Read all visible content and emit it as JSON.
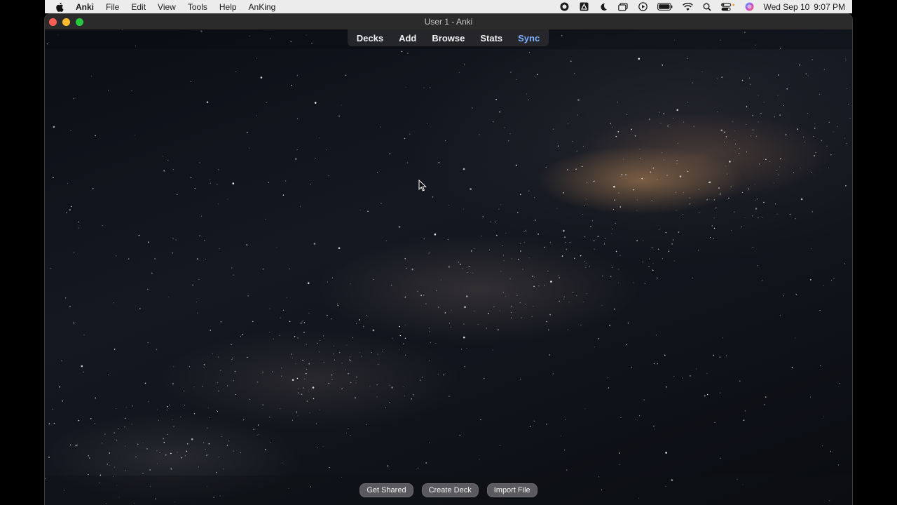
{
  "menubar": {
    "apple_icon": "apple-icon",
    "app_name": "Anki",
    "items": [
      "File",
      "Edit",
      "View",
      "Tools",
      "Help",
      "AnKing"
    ],
    "status_icons": [
      "screen-record-icon",
      "linear-app-icon",
      "moon-icon",
      "window-overlap-icon",
      "play-circle-icon",
      "battery-icon",
      "wifi-icon",
      "search-icon",
      "control-center-icon",
      "siri-icon"
    ],
    "date": "Wed Sep 10",
    "time": "9:07 PM"
  },
  "window": {
    "title": "User 1 - Anki"
  },
  "toolbar": {
    "decks": "Decks",
    "add": "Add",
    "browse": "Browse",
    "stats": "Stats",
    "sync": "Sync",
    "sync_color": "#7ab0ff"
  },
  "bottombar": {
    "get_shared": "Get Shared",
    "create_deck": "Create Deck",
    "import_file": "Import File"
  }
}
